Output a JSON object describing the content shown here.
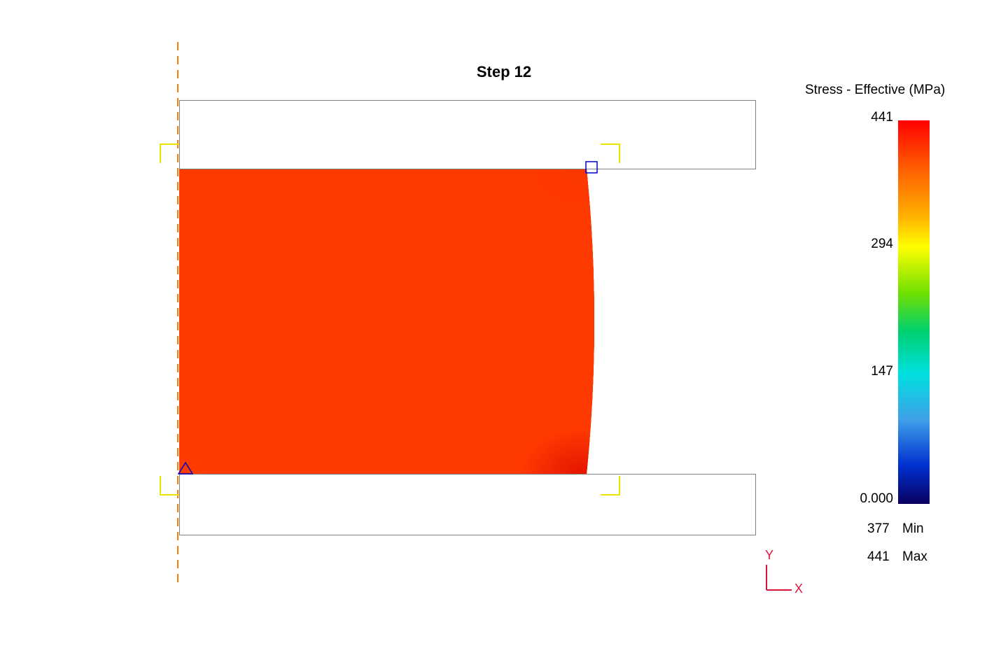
{
  "title": "Step   12",
  "legend": {
    "title": "Stress - Effective (MPa)",
    "ticks": [
      "441",
      "294",
      "147",
      "0.000"
    ],
    "min_value": "377",
    "min_label": "Min",
    "max_value": "441",
    "max_label": "Max"
  },
  "axes": {
    "y": "Y",
    "x": "X"
  },
  "chart_data": {
    "type": "heatmap",
    "title": "Step 12",
    "colorbar_label": "Stress - Effective (MPa)",
    "color_range": [
      0.0,
      441
    ],
    "color_ticks": [
      0.0,
      147,
      294,
      441
    ],
    "workpiece_field": {
      "description": "Effective stress contour on a 2D axisymmetric compression workpiece between two rigid dies. Axis of symmetry at left (dashed orange line). Stress is nearly uniform deep red (~400 MPa) with slightly lower (yellow/orange) zones near the left-top and left-bottom inner corners and a darker red concentration near the right-top and right-bottom corners adjacent to the die edges. Right free edge bulges slightly outward (barreling).",
      "min_value": 377,
      "min_location": "bottom-left corner at symmetry axis",
      "max_value": 441,
      "max_location": "top-right corner near die edge"
    },
    "dies": {
      "top": {
        "shape": "rectangle above workpiece, full width"
      },
      "bottom": {
        "shape": "rectangle below workpiece, full width"
      }
    },
    "coordinate_system": {
      "x": "radial (right)",
      "y": "axial (up)"
    }
  }
}
